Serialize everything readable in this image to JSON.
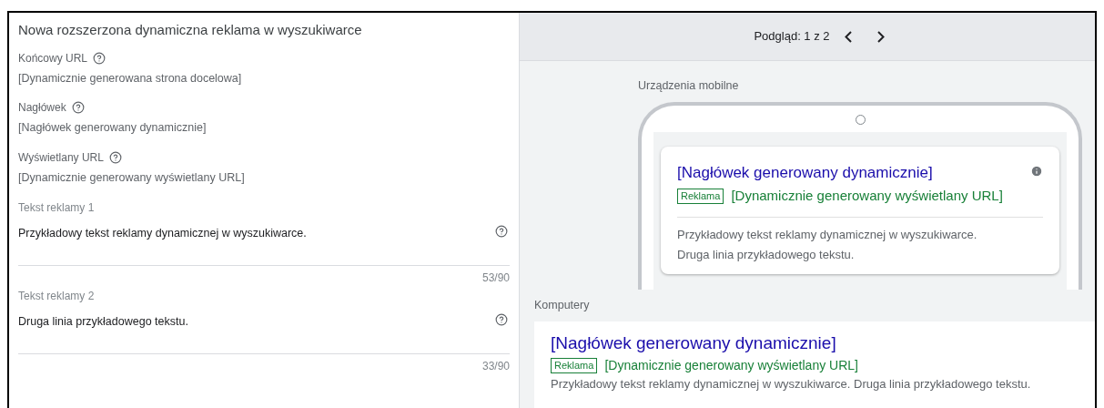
{
  "editor": {
    "title": "Nowa rozszerzona dynamiczna reklama w wyszukiwarce",
    "fields": [
      {
        "label": "Końcowy URL",
        "value": "[Dynamicznie generowana strona docelowa]"
      },
      {
        "label": "Nagłówek",
        "value": "[Nagłówek generowany dynamicznie]"
      },
      {
        "label": "Wyświetlany URL",
        "value": "[Dynamicznie generowany wyświetlany URL]"
      }
    ],
    "text_fields": [
      {
        "label": "Tekst reklamy 1",
        "value": "Przykładowy tekst reklamy dynamicznej w wyszukiwarce.",
        "counter": "53/90"
      },
      {
        "label": "Tekst reklamy 2",
        "value": "Druga linia przykładowego tekstu.",
        "counter": "33/90"
      }
    ]
  },
  "preview": {
    "pager": "Podgląd: 1 z 2",
    "mobile": {
      "label": "Urządzenia mobilne",
      "headline": "[Nagłówek generowany dynamicznie]",
      "badge": "Reklama",
      "url": "[Dynamicznie generowany wyświetlany URL]",
      "lines": [
        "Przykładowy tekst reklamy dynamicznej w wyszukiwarce.",
        "Druga linia przykładowego tekstu."
      ]
    },
    "desktop": {
      "label": "Komputery",
      "headline": "[Nagłówek generowany dynamicznie]",
      "badge": "Reklama",
      "url": "[Dynamicznie generowany wyświetlany URL]",
      "lines": [
        "Przykładowy tekst reklamy dynamicznej w wyszukiwarce. Druga linia przykładowego tekstu."
      ]
    }
  }
}
